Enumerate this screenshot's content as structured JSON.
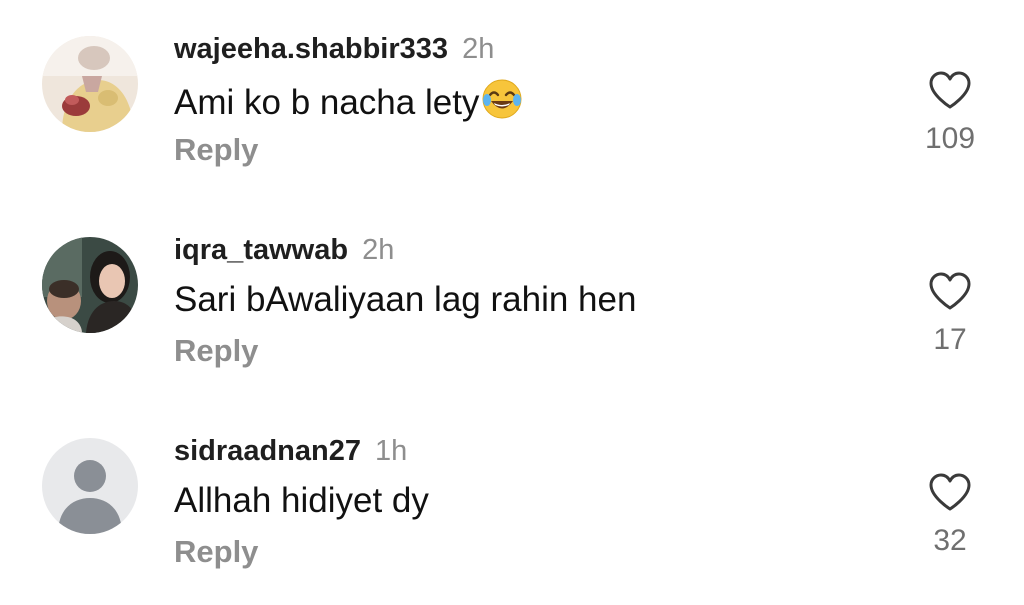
{
  "comments": [
    {
      "username": "wajeeha.shabbir333",
      "time": "2h",
      "text": "Ami ko b nacha lety",
      "emoji": "joy-laughing-emoji",
      "reply_label": "Reply",
      "likes": "109",
      "avatar": "photo-avatar"
    },
    {
      "username": "iqra_tawwab",
      "time": "2h",
      "text": "Sari bAwaliyaan lag rahin hen",
      "reply_label": "Reply",
      "likes": "17",
      "avatar": "photo-avatar"
    },
    {
      "username": "sidraadnan27",
      "time": "1h",
      "text": "Allhah hidiyet dy",
      "reply_label": "Reply",
      "likes": "32",
      "avatar": "default-person-avatar"
    }
  ],
  "icons": {
    "like": "heart-outline-icon"
  },
  "colors": {
    "username": "#1f1f1f",
    "secondary_text": "#8e8e8e",
    "like_count": "#6f6f6f",
    "default_avatar_bg": "#e8e9eb",
    "default_avatar_fg": "#8a8f96"
  }
}
